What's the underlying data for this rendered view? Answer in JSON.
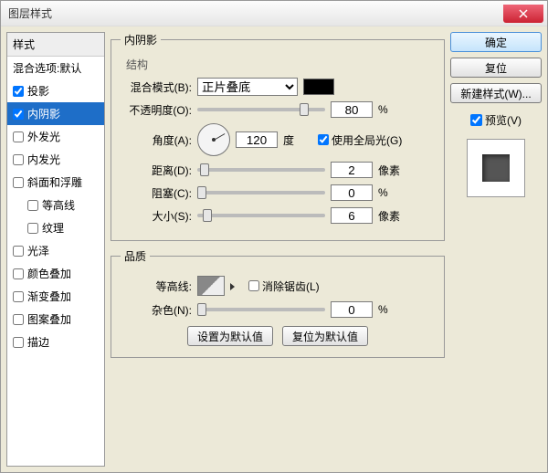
{
  "window": {
    "title": "图层样式"
  },
  "styles_panel": {
    "header": "样式",
    "items": [
      {
        "label": "混合选项:默认",
        "checked": false,
        "checkbox": false
      },
      {
        "label": "投影",
        "checked": true,
        "checkbox": true
      },
      {
        "label": "内阴影",
        "checked": true,
        "checkbox": true,
        "selected": true
      },
      {
        "label": "外发光",
        "checked": false,
        "checkbox": true
      },
      {
        "label": "内发光",
        "checked": false,
        "checkbox": true
      },
      {
        "label": "斜面和浮雕",
        "checked": false,
        "checkbox": true
      },
      {
        "label": "等高线",
        "checked": false,
        "checkbox": true,
        "indent": true
      },
      {
        "label": "纹理",
        "checked": false,
        "checkbox": true,
        "indent": true
      },
      {
        "label": "光泽",
        "checked": false,
        "checkbox": true
      },
      {
        "label": "颜色叠加",
        "checked": false,
        "checkbox": true
      },
      {
        "label": "渐变叠加",
        "checked": false,
        "checkbox": true
      },
      {
        "label": "图案叠加",
        "checked": false,
        "checkbox": true
      },
      {
        "label": "描边",
        "checked": false,
        "checkbox": true
      }
    ]
  },
  "settings": {
    "section_title": "内阴影",
    "structure_label": "结构",
    "blend_mode_label": "混合模式(B):",
    "blend_mode_value": "正片叠底",
    "color": "#000000",
    "opacity_label": "不透明度(O):",
    "opacity_value": "80",
    "opacity_unit": "%",
    "angle_label": "角度(A):",
    "angle_value": "120",
    "angle_unit": "度",
    "global_light_label": "使用全局光(G)",
    "global_light_checked": true,
    "distance_label": "距离(D):",
    "distance_value": "2",
    "distance_unit": "像素",
    "choke_label": "阻塞(C):",
    "choke_value": "0",
    "choke_unit": "%",
    "size_label": "大小(S):",
    "size_value": "6",
    "size_unit": "像素",
    "quality_label": "品质",
    "contour_label": "等高线:",
    "antialias_label": "消除锯齿(L)",
    "antialias_checked": false,
    "noise_label": "杂色(N):",
    "noise_value": "0",
    "noise_unit": "%",
    "make_default_label": "设置为默认值",
    "reset_default_label": "复位为默认值"
  },
  "buttons": {
    "ok": "确定",
    "cancel": "复位",
    "new_style": "新建样式(W)...",
    "preview": "预览(V)",
    "preview_checked": true
  }
}
